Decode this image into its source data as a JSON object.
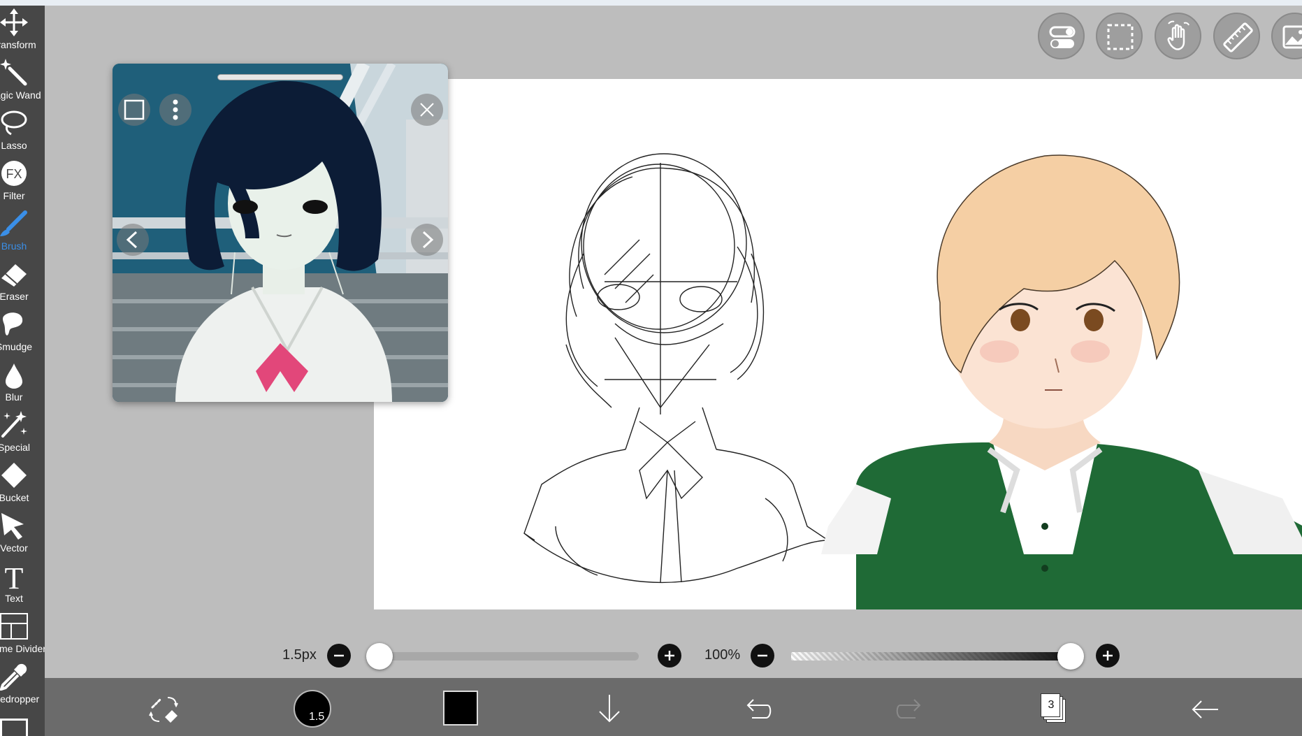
{
  "tools": [
    {
      "label": "Transform",
      "icon": "transform-icon"
    },
    {
      "label": "Magic Wand",
      "icon": "magic-wand-icon"
    },
    {
      "label": "Lasso",
      "icon": "lasso-icon"
    },
    {
      "label": "Filter",
      "icon": "filter-icon"
    },
    {
      "label": "Brush",
      "icon": "brush-icon",
      "active": true
    },
    {
      "label": "Eraser",
      "icon": "eraser-icon"
    },
    {
      "label": "Smudge",
      "icon": "smudge-icon"
    },
    {
      "label": "Blur",
      "icon": "blur-icon"
    },
    {
      "label": "Special",
      "icon": "special-icon"
    },
    {
      "label": "Bucket",
      "icon": "bucket-icon"
    },
    {
      "label": "Vector",
      "icon": "vector-icon"
    },
    {
      "label": "Text",
      "icon": "text-icon"
    },
    {
      "label": "Frame Divider",
      "icon": "frame-divider-icon"
    },
    {
      "label": "Eyedropper",
      "icon": "eyedropper-icon"
    }
  ],
  "filter_glyph": "FX",
  "text_glyph": "T",
  "top_buttons": [
    "toggle-icon",
    "selection-icon",
    "hand-icon",
    "ruler-icon",
    "reference-image-icon"
  ],
  "reference_window": {
    "prev": "<",
    "next": ">"
  },
  "brush_size": {
    "label": "1.5px",
    "value": 1.5,
    "min": 0.1,
    "max": 1000,
    "position_fraction": 0.02
  },
  "opacity": {
    "label": "100%",
    "value": 100
  },
  "bottom_bar": {
    "brush_size_badge": "1.5",
    "primary_color": "#000000",
    "layer_count": "3"
  },
  "colors": {
    "toolbar": "#474747",
    "accent": "#3a8fe8",
    "bottom_bar": "#6b6b6b",
    "workspace": "#bdbdbd"
  }
}
